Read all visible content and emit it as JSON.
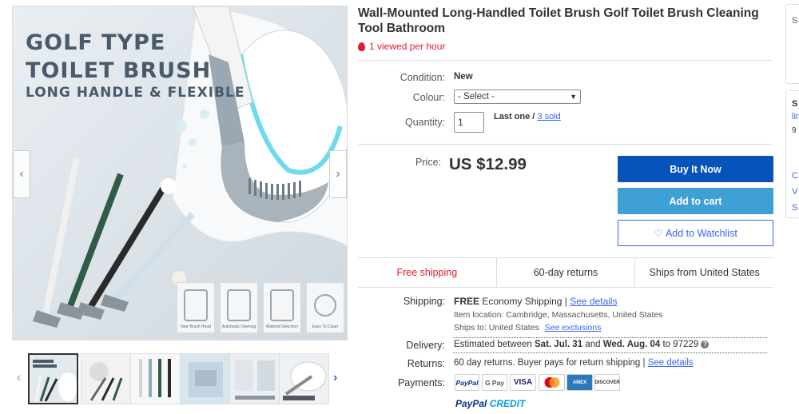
{
  "listing": {
    "title": "Wall-Mounted Long-Handled Toilet Brush Golf Toilet Brush Cleaning Tool Bathroom",
    "views": "1 viewed per hour"
  },
  "gallery": {
    "image_text_line1": "GOLF TYPE",
    "image_text_line2": "TOILET BRUSH",
    "image_text_line3": "LONG HANDLE & FLEXIBLE",
    "tiles": [
      "New Brush Head",
      "Automatic Opening",
      "Material Selection",
      "Easy To Clean"
    ],
    "prev_arrow": "‹",
    "next_arrow": "›",
    "thumb_prev": "‹",
    "thumb_next": "›"
  },
  "specifics": {
    "condition_label": "Condition:",
    "condition_value": "New",
    "colour_label": "Colour:",
    "colour_selected": "- Select -",
    "quantity_label": "Quantity:",
    "quantity_value": "1",
    "stock_text": "Last one /",
    "sold_link": "3 sold"
  },
  "price": {
    "label": "Price:",
    "value": "US $12.99"
  },
  "buttons": {
    "buy_now": "Buy It Now",
    "add_to_cart": "Add to cart",
    "watchlist": "Add to Watchlist"
  },
  "infobar": [
    "Free shipping",
    "60-day returns",
    "Ships from United States"
  ],
  "shipping": {
    "label": "Shipping:",
    "free": "FREE",
    "method": "Economy Shipping |",
    "see_details": "See details",
    "location_label": "Item location:",
    "location": "Cambridge, Massachusetts, United States",
    "ships_to_label": "Ships to:",
    "ships_to": "United States",
    "see_exclusions": "See exclusions"
  },
  "delivery": {
    "label": "Delivery:",
    "text_pre": "Estimated between",
    "date1": "Sat. Jul. 31",
    "and": "and",
    "date2": "Wed. Aug. 04",
    "to_zip": "to 97229"
  },
  "returns": {
    "label": "Returns:",
    "text": "60 day returns. Buyer pays for return shipping |",
    "see_details": "See details"
  },
  "payments": {
    "label": "Payments:",
    "methods": [
      "PayPal",
      "G Pay",
      "VISA",
      "MC",
      "AMEX",
      "DISCOVER"
    ],
    "credit_1": "PayPal",
    "credit_2": "CREDIT"
  },
  "side": {
    "s1": "S",
    "s2": "S",
    "t1": "lin",
    "t2": "9",
    "t3": "C",
    "t4": "V",
    "t5": "S"
  },
  "colors": {
    "ebay_blue": "#3665f3",
    "buy_now_bg": "#0654ba",
    "cart_bg": "#3fa0d6",
    "alert_red": "#dd1e31"
  }
}
